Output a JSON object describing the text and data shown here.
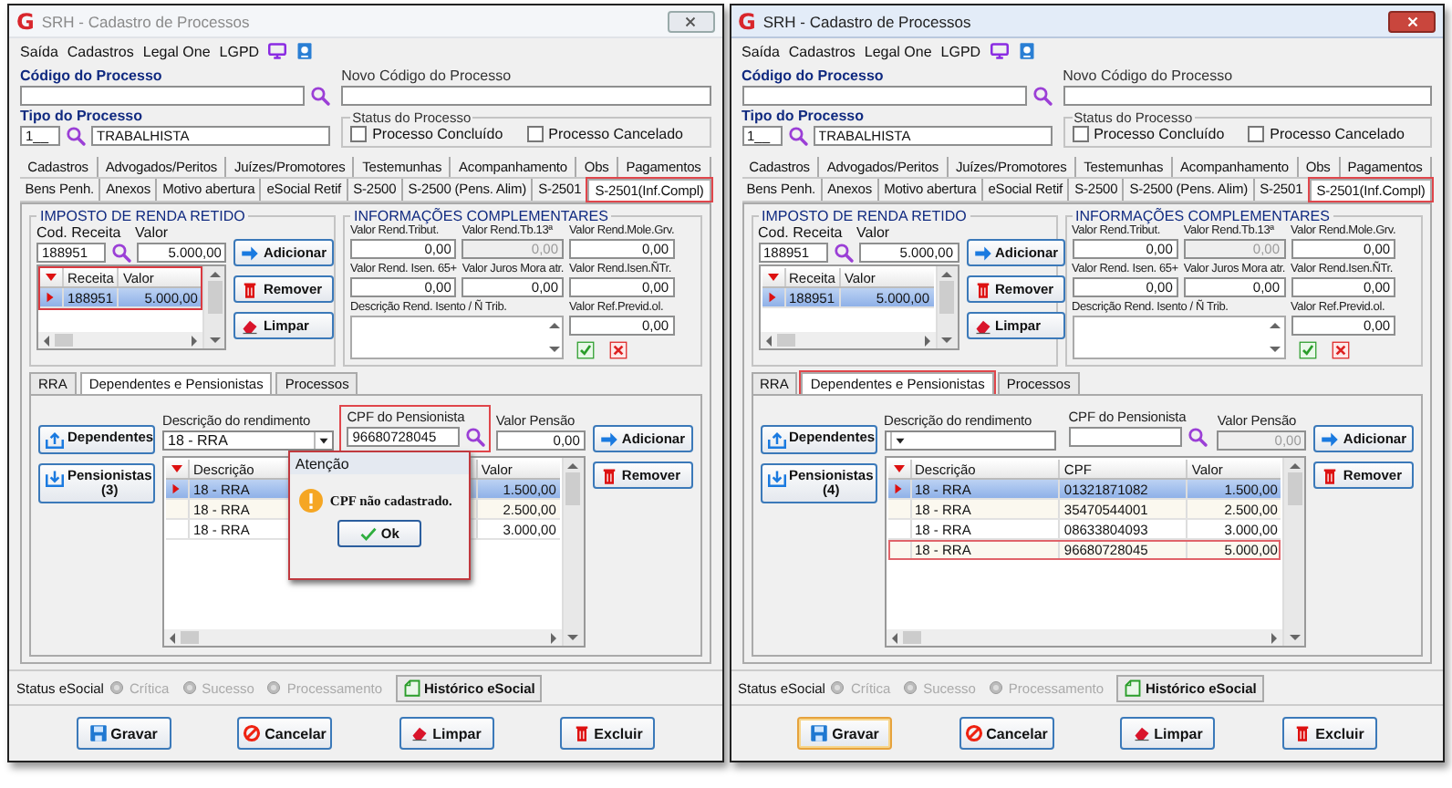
{
  "windows": [
    {
      "logo": "G",
      "title": "SRH - Cadastro de Processos",
      "active": false,
      "menu": [
        "Saída",
        "Cadastros",
        "Legal One",
        "LGPD"
      ],
      "codigo": {
        "label": "Código do Processo"
      },
      "novo_codigo": {
        "label": "Novo Código do Processo"
      },
      "tipo": {
        "label": "Tipo do Processo",
        "code": "1__",
        "description": "TRABALHISTA"
      },
      "status_group": {
        "title": "Status do Processo",
        "options": [
          {
            "label": "Processo Concluído",
            "checked": false
          },
          {
            "label": "Processo Cancelado",
            "checked": false
          }
        ]
      },
      "tab_rows": [
        [
          {
            "label": "Cadastros",
            "selected": false,
            "highlighted": false
          },
          {
            "label": "Advogados/Peritos",
            "selected": false,
            "highlighted": false
          },
          {
            "label": "Juízes/Promotores",
            "selected": false,
            "highlighted": false
          },
          {
            "label": "Testemunhas",
            "selected": false,
            "highlighted": false
          },
          {
            "label": "Acompanhamento",
            "selected": false,
            "highlighted": false
          },
          {
            "label": "Obs",
            "selected": false,
            "highlighted": false
          },
          {
            "label": "Pagamentos",
            "selected": false,
            "highlighted": false
          }
        ],
        [
          {
            "label": "Bens Penh.",
            "selected": false,
            "highlighted": false
          },
          {
            "label": "Anexos",
            "selected": false,
            "highlighted": false
          },
          {
            "label": "Motivo abertura",
            "selected": false,
            "highlighted": false
          },
          {
            "label": "eSocial Retif",
            "selected": false,
            "highlighted": false
          },
          {
            "label": "S-2500",
            "selected": false,
            "highlighted": false
          },
          {
            "label": "S-2500 (Pens. Alim)",
            "selected": false,
            "highlighted": false
          },
          {
            "label": "S-2501",
            "selected": false,
            "highlighted": false
          },
          {
            "label": "S-2501(Inf.Compl)",
            "selected": true,
            "highlighted": true
          }
        ]
      ],
      "ir": {
        "title": "IMPOSTO DE RENDA RETIDO",
        "cod_label": "Cod. Receita",
        "cod_value": "188951",
        "valor_label": "Valor",
        "valor_value": "5.000,00",
        "add": "Adicionar",
        "remove": "Remover",
        "clear": "Limpar",
        "grid": {
          "highlighted": true,
          "columns": [
            "Receita",
            "Valor"
          ],
          "rows": [
            {
              "cells": [
                "188951",
                "5.000,00"
              ],
              "selected": true,
              "highlighted": false
            }
          ]
        }
      },
      "info": {
        "title": "INFORMAÇÕES COMPLEMENTARES",
        "fields": [
          {
            "label": "Valor Rend.Tribut.",
            "value": "0,00",
            "disabled": false
          },
          {
            "label": "Valor Rend.Tb.13ª",
            "value": "0,00",
            "disabled": true
          },
          {
            "label": "Valor Rend.Mole.Grv.",
            "value": "0,00",
            "disabled": false
          },
          {
            "label": "Valor Rend. Isen. 65+",
            "value": "0,00",
            "disabled": false
          },
          {
            "label": "Valor Juros Mora atr.",
            "value": "0,00",
            "disabled": false
          },
          {
            "label": "Valor Rend.Isen.ÑTr.",
            "value": "0,00",
            "disabled": false
          }
        ],
        "desc_label": "Descrição Rend. Isento / Ñ Trib.",
        "prev_label": "Valor Ref.Previd.ol.",
        "prev_value": "0,00"
      },
      "subtabs": [
        {
          "label": "RRA",
          "selected": false,
          "highlighted": false
        },
        {
          "label": "Dependentes e Pensionistas",
          "selected": true,
          "highlighted": false
        },
        {
          "label": "Processos",
          "selected": false,
          "highlighted": false
        }
      ],
      "pens": {
        "dependentes": "Dependentes",
        "pensionistas": "Pensionistas (3)",
        "desc_label": "Descrição do rendimento",
        "desc_value": "18 - RRA",
        "cpf_label": "CPF do Pensionista",
        "cpf_value": "96680728045",
        "cpf_highlighted": true,
        "valor_label": "Valor Pensão",
        "valor_value": "0,00",
        "valor_disabled": false,
        "add": "Adicionar",
        "remove": "Remover",
        "grid": {
          "highlighted": false,
          "columns": [
            "Descrição",
            "Valor"
          ],
          "rows": [
            {
              "cells": [
                "18 - RRA",
                "1.500,00"
              ],
              "selected": true,
              "highlighted": false
            },
            {
              "cells": [
                "18 - RRA",
                "2.500,00"
              ],
              "selected": false,
              "highlighted": false
            },
            {
              "cells": [
                "18 - RRA",
                "3.000,00"
              ],
              "selected": false,
              "highlighted": false
            }
          ]
        }
      },
      "status": {
        "label": "Status eSocial",
        "options": [
          {
            "label": "Crítica",
            "disabled": true
          },
          {
            "label": "Sucesso",
            "disabled": true
          },
          {
            "label": "Processamento",
            "disabled": true
          }
        ],
        "history": "Histórico eSocial"
      },
      "buttons": [
        {
          "kind": "save",
          "label": "Gravar",
          "focused": false
        },
        {
          "kind": "cancel",
          "label": "Cancelar",
          "focused": false
        },
        {
          "kind": "clear",
          "label": "Limpar",
          "focused": false
        },
        {
          "kind": "delete",
          "label": "Excluir",
          "focused": false
        }
      ],
      "dialog": {
        "title": "Atenção",
        "message": "CPF não cadastrado.",
        "button": "Ok"
      }
    },
    {
      "logo": "G",
      "title": "SRH - Cadastro de Processos",
      "active": true,
      "menu": [
        "Saída",
        "Cadastros",
        "Legal One",
        "LGPD"
      ],
      "codigo": {
        "label": "Código do Processo"
      },
      "novo_codigo": {
        "label": "Novo Código do Processo"
      },
      "tipo": {
        "label": "Tipo do Processo",
        "code": "1__",
        "description": "TRABALHISTA"
      },
      "status_group": {
        "title": "Status do Processo",
        "options": [
          {
            "label": "Processo Concluído",
            "checked": false
          },
          {
            "label": "Processo Cancelado",
            "checked": false
          }
        ]
      },
      "tab_rows": [
        [
          {
            "label": "Cadastros",
            "selected": false,
            "highlighted": false
          },
          {
            "label": "Advogados/Peritos",
            "selected": false,
            "highlighted": false
          },
          {
            "label": "Juízes/Promotores",
            "selected": false,
            "highlighted": false
          },
          {
            "label": "Testemunhas",
            "selected": false,
            "highlighted": false
          },
          {
            "label": "Acompanhamento",
            "selected": false,
            "highlighted": false
          },
          {
            "label": "Obs",
            "selected": false,
            "highlighted": false
          },
          {
            "label": "Pagamentos",
            "selected": false,
            "highlighted": false
          }
        ],
        [
          {
            "label": "Bens Penh.",
            "selected": false,
            "highlighted": false
          },
          {
            "label": "Anexos",
            "selected": false,
            "highlighted": false
          },
          {
            "label": "Motivo abertura",
            "selected": false,
            "highlighted": false
          },
          {
            "label": "eSocial Retif",
            "selected": false,
            "highlighted": false
          },
          {
            "label": "S-2500",
            "selected": false,
            "highlighted": false
          },
          {
            "label": "S-2500 (Pens. Alim)",
            "selected": false,
            "highlighted": false
          },
          {
            "label": "S-2501",
            "selected": false,
            "highlighted": false
          },
          {
            "label": "S-2501(Inf.Compl)",
            "selected": true,
            "highlighted": true
          }
        ]
      ],
      "ir": {
        "title": "IMPOSTO DE RENDA RETIDO",
        "cod_label": "Cod. Receita",
        "cod_value": "188951",
        "valor_label": "Valor",
        "valor_value": "5.000,00",
        "add": "Adicionar",
        "remove": "Remover",
        "clear": "Limpar",
        "grid": {
          "highlighted": false,
          "columns": [
            "Receita",
            "Valor"
          ],
          "rows": [
            {
              "cells": [
                "188951",
                "5.000,00"
              ],
              "selected": true,
              "highlighted": false
            }
          ]
        }
      },
      "info": {
        "title": "INFORMAÇÕES COMPLEMENTARES",
        "fields": [
          {
            "label": "Valor Rend.Tribut.",
            "value": "0,00",
            "disabled": false
          },
          {
            "label": "Valor Rend.Tb.13ª",
            "value": "0,00",
            "disabled": true
          },
          {
            "label": "Valor Rend.Mole.Grv.",
            "value": "0,00",
            "disabled": false
          },
          {
            "label": "Valor Rend. Isen. 65+",
            "value": "0,00",
            "disabled": false
          },
          {
            "label": "Valor Juros Mora atr.",
            "value": "0,00",
            "disabled": false
          },
          {
            "label": "Valor Rend.Isen.ÑTr.",
            "value": "0,00",
            "disabled": false
          }
        ],
        "desc_label": "Descrição Rend. Isento / Ñ Trib.",
        "prev_label": "Valor Ref.Previd.ol.",
        "prev_value": "0,00"
      },
      "subtabs": [
        {
          "label": "RRA",
          "selected": false,
          "highlighted": false
        },
        {
          "label": "Dependentes e Pensionistas",
          "selected": true,
          "highlighted": true
        },
        {
          "label": "Processos",
          "selected": false,
          "highlighted": false
        }
      ],
      "pens": {
        "dependentes": "Dependentes",
        "pensionistas": "Pensionistas (4)",
        "desc_label": "Descrição do rendimento",
        "cpf_label": "CPF do Pensionista",
        "cpf_highlighted": false,
        "valor_label": "Valor Pensão",
        "valor_value": "0,00",
        "valor_disabled": true,
        "add": "Adicionar",
        "remove": "Remover",
        "grid": {
          "highlighted": false,
          "columns": [
            "Descrição",
            "CPF",
            "Valor"
          ],
          "rows": [
            {
              "cells": [
                "18 - RRA",
                "01321871082",
                "1.500,00"
              ],
              "selected": true,
              "highlighted": false
            },
            {
              "cells": [
                "18 - RRA",
                "35470544001",
                "2.500,00"
              ],
              "selected": false,
              "highlighted": false
            },
            {
              "cells": [
                "18 - RRA",
                "08633804093",
                "3.000,00"
              ],
              "selected": false,
              "highlighted": false
            },
            {
              "cells": [
                "18 - RRA",
                "96680728045",
                "5.000,00"
              ],
              "selected": false,
              "highlighted": true
            }
          ]
        }
      },
      "status": {
        "label": "Status eSocial",
        "options": [
          {
            "label": "Crítica",
            "disabled": true
          },
          {
            "label": "Sucesso",
            "disabled": true
          },
          {
            "label": "Processamento",
            "disabled": true
          }
        ],
        "history": "Histórico eSocial"
      },
      "buttons": [
        {
          "kind": "save",
          "label": "Gravar",
          "focused": true
        },
        {
          "kind": "cancel",
          "label": "Cancelar",
          "focused": false
        },
        {
          "kind": "clear",
          "label": "Limpar",
          "focused": false
        },
        {
          "kind": "delete",
          "label": "Excluir",
          "focused": false
        }
      ]
    }
  ]
}
